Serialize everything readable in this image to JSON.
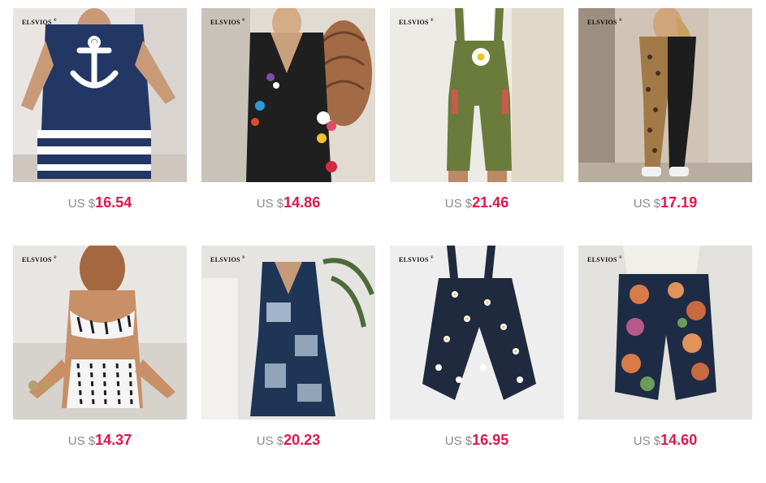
{
  "brand_mark": "ELSVIOS",
  "currency_prefix": "US $",
  "products": [
    {
      "price": "16.54",
      "brand": "ELSVIOS",
      "alt": "Navy anchor print top and striped shorts set",
      "icon": "anchor"
    },
    {
      "price": "14.86",
      "brand": "ELSVIOS",
      "alt": "Black floral embroidered jumpsuit",
      "icon": "flower"
    },
    {
      "price": "21.46",
      "brand": "ELSVIOS",
      "alt": "Olive daisy print overalls",
      "icon": "daisy"
    },
    {
      "price": "17.19",
      "brand": "ELSVIOS",
      "alt": "Black and leopard patchwork jumpsuit",
      "icon": "leopard"
    },
    {
      "price": "14.37",
      "brand": "ELSVIOS",
      "alt": "White tie-dye crop top and shorts set",
      "icon": "stripes"
    },
    {
      "price": "20.23",
      "brand": "ELSVIOS",
      "alt": "Navy tie-dye wide leg jumpsuit",
      "icon": "tie-dye"
    },
    {
      "price": "16.95",
      "brand": "ELSVIOS",
      "alt": "Navy daisy print harem overalls",
      "icon": "daisy"
    },
    {
      "price": "14.60",
      "brand": "ELSVIOS",
      "alt": "Floral print harem pants",
      "icon": "flower"
    }
  ],
  "colors": {
    "price": "#e0164b",
    "currency": "#8a8a8a",
    "navy": "#1f2f5c",
    "olive": "#6b7b3c"
  }
}
